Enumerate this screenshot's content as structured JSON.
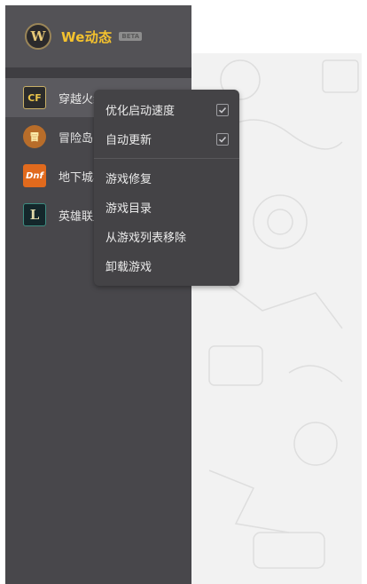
{
  "app": {
    "brand": "We动态",
    "badge": "BETA",
    "logo_letter": "W"
  },
  "games": [
    {
      "icon": "crossfire-icon",
      "icon_text": "CF",
      "label": "穿越火线",
      "active": true
    },
    {
      "icon": "maplestory-icon",
      "icon_text": "冒",
      "label": "冒险岛",
      "active": false
    },
    {
      "icon": "dnf-icon",
      "icon_text": "Dnf",
      "label": "地下城与勇士",
      "active": false
    },
    {
      "icon": "lol-icon",
      "icon_text": "L",
      "label": "英雄联盟",
      "active": false
    }
  ],
  "context_menu": {
    "items": [
      {
        "label": "优化启动速度",
        "checked": true
      },
      {
        "label": "自动更新",
        "checked": true
      },
      {
        "label": "游戏修复"
      },
      {
        "label": "游戏目录"
      },
      {
        "label": "从游戏列表移除"
      },
      {
        "label": "卸载游戏"
      }
    ]
  },
  "colors": {
    "sidebar": "#48474b",
    "menu": "#444346",
    "brand": "#f4c22e",
    "content": "#f2f2f2"
  }
}
